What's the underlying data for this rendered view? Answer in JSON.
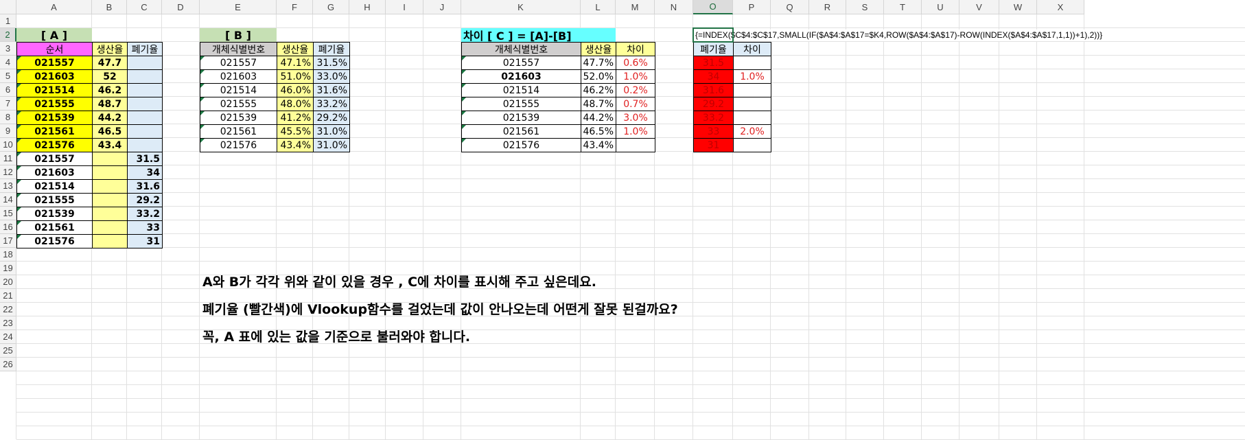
{
  "columns": [
    "A",
    "B",
    "C",
    "D",
    "E",
    "F",
    "G",
    "H",
    "I",
    "J",
    "K",
    "L",
    "M",
    "N",
    "O",
    "P",
    "Q",
    "R",
    "S",
    "T",
    "U",
    "V",
    "W",
    "X"
  ],
  "rows": [
    "1",
    "2",
    "3",
    "4",
    "5",
    "6",
    "7",
    "8",
    "9",
    "10",
    "11",
    "12",
    "13",
    "14",
    "15",
    "16",
    "17",
    "18",
    "19",
    "20",
    "21",
    "22",
    "23",
    "24",
    "25",
    "26"
  ],
  "selected_column": "O",
  "selected_row": "2",
  "formula": "{=INDEX($C$4:$C$17,SMALL(IF($A$4:$A$17=$K4,ROW($A$4:$A$17)-ROW(INDEX($A$4:$A$17,1,1))+1),2))}",
  "table_a": {
    "title": "[ A ]",
    "headers": [
      "순서",
      "생산율",
      "폐기율"
    ],
    "rows": [
      [
        "021557",
        "47.7",
        ""
      ],
      [
        "021603",
        "52",
        ""
      ],
      [
        "021514",
        "46.2",
        ""
      ],
      [
        "021555",
        "48.7",
        ""
      ],
      [
        "021539",
        "44.2",
        ""
      ],
      [
        "021561",
        "46.5",
        ""
      ],
      [
        "021576",
        "43.4",
        ""
      ],
      [
        "021557",
        "",
        "31.5"
      ],
      [
        "021603",
        "",
        "34"
      ],
      [
        "021514",
        "",
        "31.6"
      ],
      [
        "021555",
        "",
        "29.2"
      ],
      [
        "021539",
        "",
        "33.2"
      ],
      [
        "021561",
        "",
        "33"
      ],
      [
        "021576",
        "",
        "31"
      ]
    ]
  },
  "table_b": {
    "title": "[ B ]",
    "headers": [
      "개체식별번호",
      "생산율",
      "폐기율"
    ],
    "rows": [
      [
        "021557",
        "47.1%",
        "31.5%"
      ],
      [
        "021603",
        "51.0%",
        "33.0%"
      ],
      [
        "021514",
        "46.0%",
        "31.6%"
      ],
      [
        "021555",
        "48.0%",
        "33.2%"
      ],
      [
        "021539",
        "41.2%",
        "29.2%"
      ],
      [
        "021561",
        "45.5%",
        "31.0%"
      ],
      [
        "021576",
        "43.4%",
        "31.0%"
      ]
    ]
  },
  "table_c": {
    "title": "차이 [ C ] = [A]-[B]",
    "headers": [
      "개체식별번호",
      "생산율",
      "차이"
    ],
    "rows": [
      [
        "021557",
        "47.7%",
        "0.6%"
      ],
      [
        "021603",
        "52.0%",
        "1.0%"
      ],
      [
        "021514",
        "46.2%",
        "0.2%"
      ],
      [
        "021555",
        "48.7%",
        "0.7%"
      ],
      [
        "021539",
        "44.2%",
        "3.0%"
      ],
      [
        "021561",
        "46.5%",
        "1.0%"
      ],
      [
        "021576",
        "43.4%",
        ""
      ]
    ]
  },
  "table_d": {
    "headers": [
      "폐기율",
      "차이"
    ],
    "rows": [
      [
        "31.5",
        ""
      ],
      [
        "34",
        "1.0%"
      ],
      [
        "31.6",
        ""
      ],
      [
        "29.2",
        ""
      ],
      [
        "33.2",
        ""
      ],
      [
        "33",
        "2.0%"
      ],
      [
        "31",
        ""
      ]
    ]
  },
  "notes": [
    "A와 B가 각각 위와 같이 있을 경우 ,  C에 차이를 표시해 주고 싶은데요.",
    "폐기율 (빨간색)에 Vlookup함수를 걸었는데 값이 안나오는데 어떤게 잘못 된걸까요?",
    "꼭, A 표에 있는 값을 기준으로 불러와야 합니다."
  ],
  "colors": {
    "green_title": "#c6e0b4",
    "pink": "#ff66ff",
    "yellow": "#ffff00",
    "light_yellow": "#ffff99",
    "light_blue": "#ddebf7",
    "gray_header": "#d0cece",
    "cyan": "#66ffff",
    "red_fill": "#ff0000",
    "red_text": "#e02020",
    "excel_green": "#217346"
  }
}
